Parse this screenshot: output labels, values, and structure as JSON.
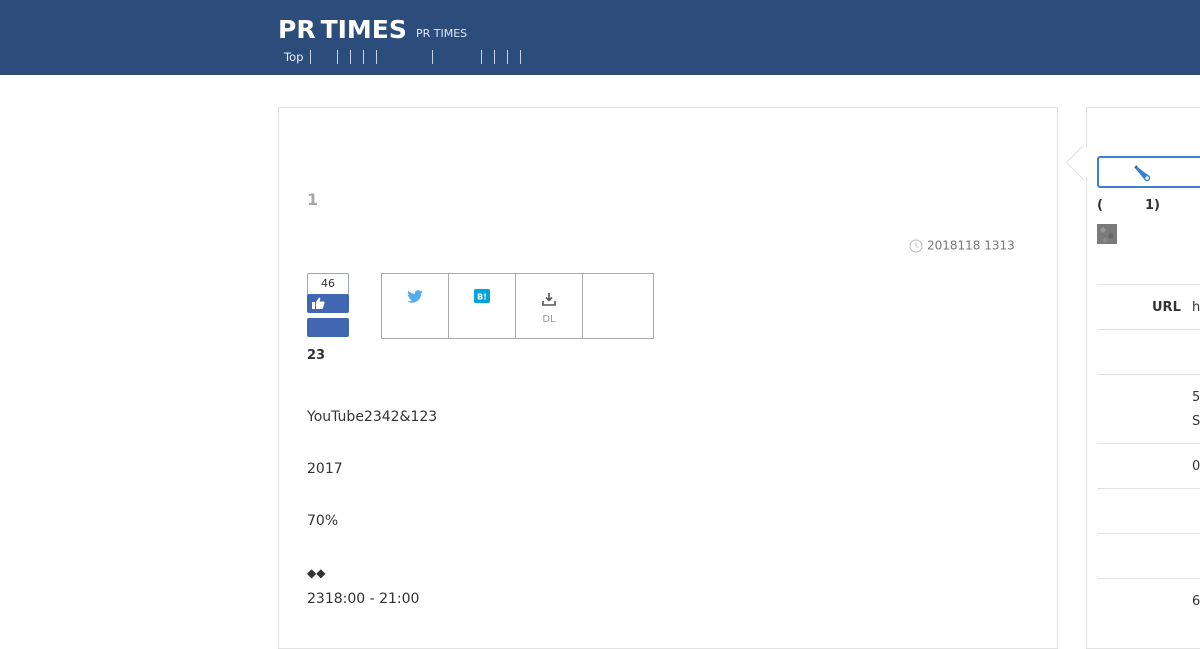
{
  "header": {
    "logo_pr": "PR",
    "logo_times": "TIMES",
    "subtitle": "PR TIMES",
    "nav": {
      "top": "Top"
    }
  },
  "article": {
    "number": "1",
    "date": "2018118 1313",
    "like_count": "46",
    "like_total": "23",
    "share": {
      "download_label": "DL"
    },
    "lines": [
      "YouTube2342&123",
      "2017",
      "70%",
      "◆◆",
      "2318:00 - 21:00"
    ]
  },
  "sidebar": {
    "paren_open": "(",
    "paren_count": "1)",
    "url_label": "URL",
    "url_value": "h",
    "values": [
      "5",
      "S",
      "0",
      "6"
    ]
  },
  "colors": {
    "header_bg": "#2c4d7c",
    "facebook_blue": "#4267b2",
    "twitter_blue": "#55acee",
    "hatena_blue": "#00a4de",
    "search_border": "#3b7fd0"
  }
}
